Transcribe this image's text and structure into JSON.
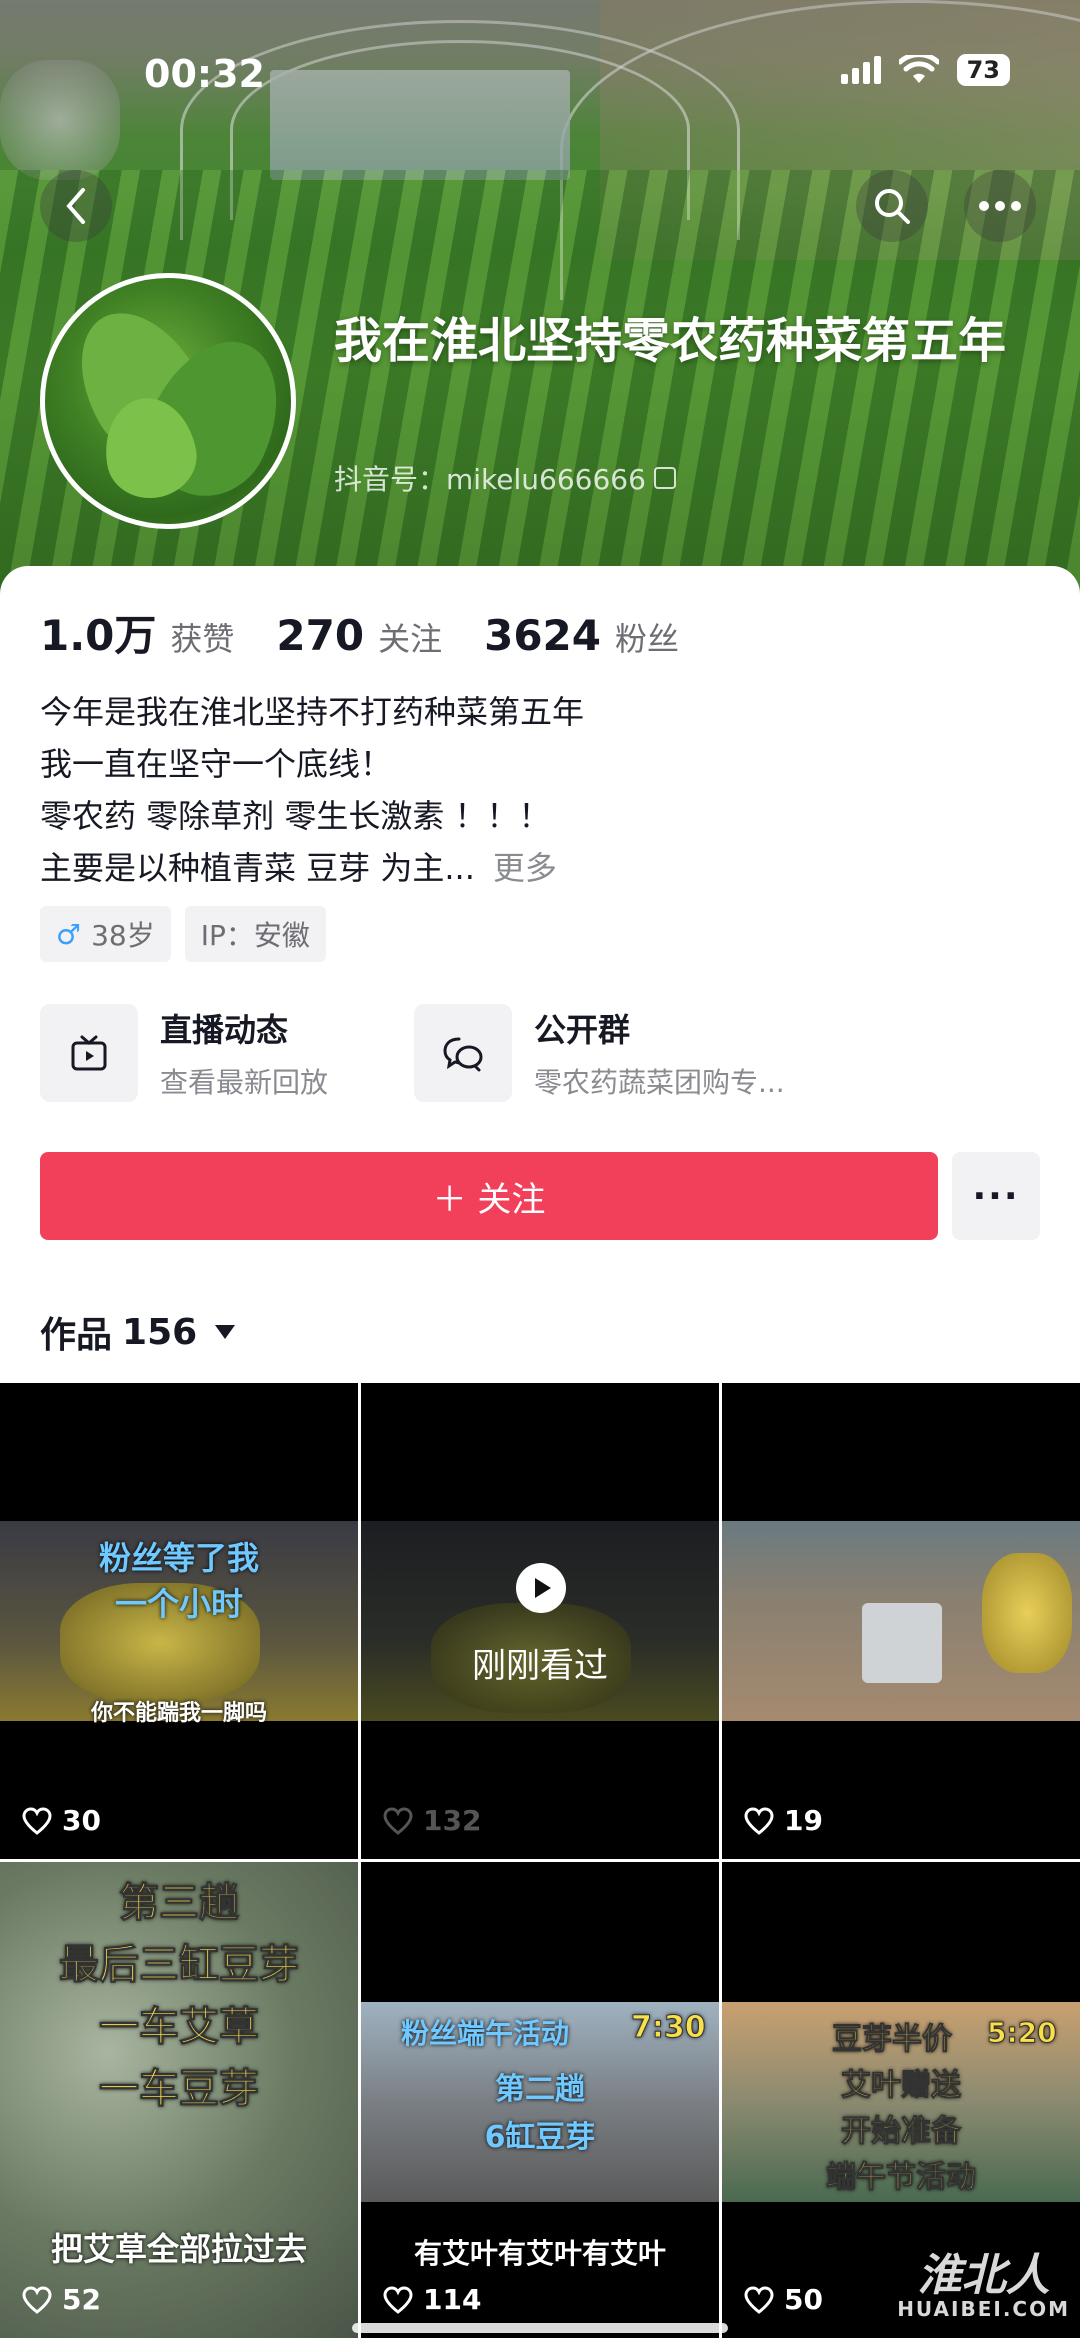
{
  "status_bar": {
    "time": "00:32",
    "battery": "73"
  },
  "profile": {
    "nickname": "我在淮北坚持零农药种菜第五年",
    "douyin_id": "抖音号：mikelu666666",
    "stats": [
      {
        "num": "1.0万",
        "label": "获赞"
      },
      {
        "num": "270",
        "label": "关注"
      },
      {
        "num": "3624",
        "label": "粉丝"
      }
    ],
    "bio_lines": [
      "今年是我在淮北坚持不打药种菜第五年",
      "我一直在坚守一个底线！",
      "零农药 零除草剂 零生长激素 ！！！",
      "主要是以种植青菜 豆芽 为主..."
    ],
    "bio_more": "更多",
    "tags": {
      "age": "38岁",
      "ip": "IP：安徽"
    }
  },
  "features": [
    {
      "icon": "tv-icon",
      "title": "直播动态",
      "subtitle": "查看最新回放"
    },
    {
      "icon": "chat-bubbles-icon",
      "title": "公开群",
      "subtitle": "零农药蔬菜团购专..."
    }
  ],
  "actions": {
    "follow_label": "＋ 关注",
    "more_label": "···"
  },
  "works_tab": {
    "label": "作品",
    "count": "156"
  },
  "videos": [
    {
      "likes": "30",
      "texts": [
        "粉丝等了我",
        "一个小时",
        "你不能踹我一脚吗"
      ]
    },
    {
      "likes": "132",
      "watched": "刚刚看过"
    },
    {
      "likes": "19"
    },
    {
      "likes": "52",
      "texts": [
        "第三趟",
        "最后三缸豆芽",
        "一车艾草",
        "一车豆芽",
        "把艾草全部拉过去"
      ]
    },
    {
      "likes": "114",
      "texts": [
        "粉丝端午活动",
        "7:30",
        "第二趟",
        "6缸豆芽",
        "有艾叶有艾叶有艾叶"
      ]
    },
    {
      "likes": "50",
      "texts": [
        "豆芽半价",
        "5:20",
        "艾叶赠送",
        "开始准备",
        "端午节活动"
      ]
    }
  ],
  "watermark": {
    "text": "淮北人",
    "sub": "HUAIBEI.COM"
  }
}
